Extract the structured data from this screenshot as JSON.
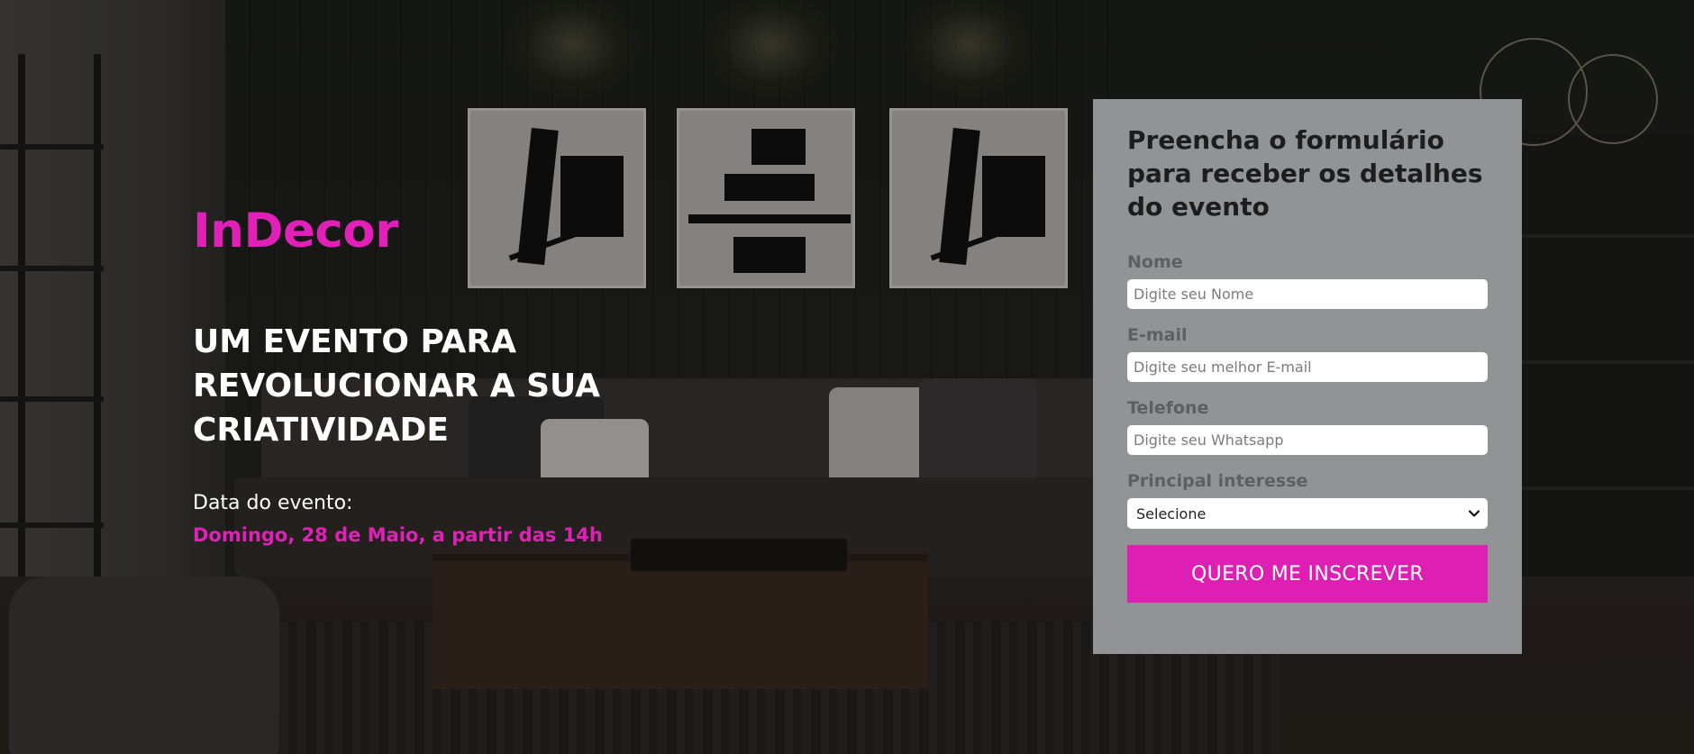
{
  "hero": {
    "brand": "InDecor",
    "headline": "UM EVENTO PARA REVOLUCIONAR A SUA CRIATIVIDADE",
    "date_label": "Data do evento:",
    "date_value": "Domingo, 28 de Maio, a partir das 14h"
  },
  "form": {
    "title": "Preencha o formulário para receber os detalhes do evento",
    "fields": [
      {
        "label": "Nome",
        "placeholder": "Digite seu Nome"
      },
      {
        "label": "E-mail",
        "placeholder": "Digite seu melhor E-mail"
      },
      {
        "label": "Telefone",
        "placeholder": "Digite seu Whatsapp"
      }
    ],
    "interest": {
      "label": "Principal interesse",
      "selected": "Selecione"
    },
    "submit_label": "QUERO ME INSCREVER"
  },
  "colors": {
    "accent": "#e020b6",
    "card_bg": "#929395",
    "button_bg": "#dd1fb4"
  },
  "icons": {
    "select_arrow": "chevron-down-icon"
  }
}
